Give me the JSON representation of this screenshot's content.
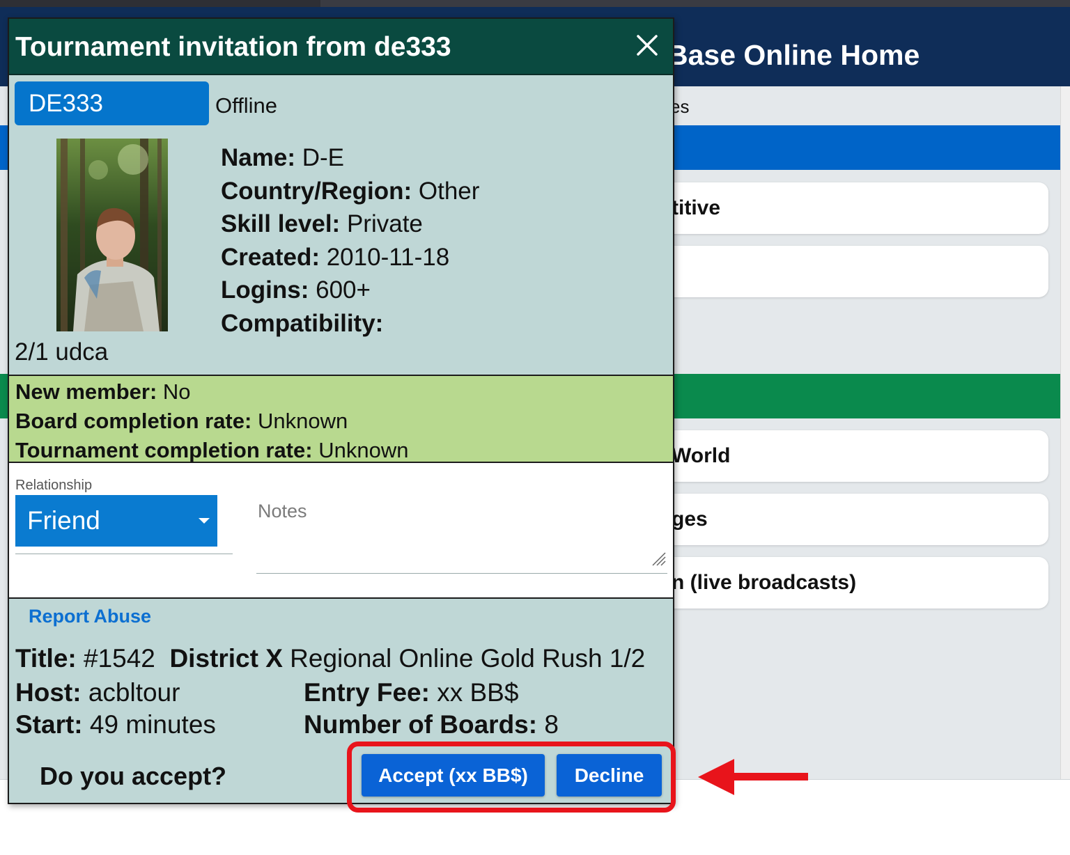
{
  "background": {
    "header_title": "Base Online Home",
    "subtab_label": "es",
    "cards_group1": [
      "titive",
      ""
    ],
    "cards_group2": [
      "World",
      "ges",
      "n (live broadcasts)"
    ],
    "colors": {
      "header": "#0f2d58",
      "blue_bar": "#0064c8",
      "green_bar": "#0a8a4d"
    }
  },
  "dialog": {
    "title": "Tournament invitation from de333",
    "close_icon": "close-icon",
    "user": {
      "handle": "DE333",
      "status": "Offline"
    },
    "profile": {
      "name_label": "Name:",
      "name": "D-E",
      "country_label": "Country/Region:",
      "country": "Other",
      "skill_label": "Skill level:",
      "skill": "Private",
      "created_label": "Created:",
      "created": "2010-11-18",
      "logins_label": "Logins:",
      "logins": "600+",
      "compat_label": "Compatibility:",
      "compat": "",
      "system": "2/1 udca"
    },
    "stats": {
      "new_member_label": "New member:",
      "new_member": "No",
      "board_rate_label": "Board completion rate:",
      "board_rate": "Unknown",
      "tourn_rate_label": "Tournament completion rate:",
      "tourn_rate": "Unknown"
    },
    "relationship": {
      "label": "Relationship",
      "value": "Friend",
      "notes_placeholder": "Notes",
      "notes_value": ""
    },
    "report_abuse": "Report Abuse",
    "tournament": {
      "title_label": "Title:",
      "title": "#1542",
      "district_label": "District X",
      "district_rest": "Regional Online Gold Rush 1/2",
      "host_label": "Host:",
      "host": "acbltour",
      "fee_label": "Entry Fee:",
      "fee": "xx BB$",
      "start_label": "Start:",
      "start": "49 minutes",
      "boards_label": "Number of Boards:",
      "boards": "8"
    },
    "prompt": "Do you accept?",
    "accept_button": "Accept (xx BB$)",
    "decline_button": "Decline",
    "colors": {
      "header": "#0a4a40",
      "body": "#bfd7d6",
      "stats": "#b8d98f",
      "button": "#0a63d6"
    }
  },
  "annotation": {
    "color": "#e8141b"
  }
}
